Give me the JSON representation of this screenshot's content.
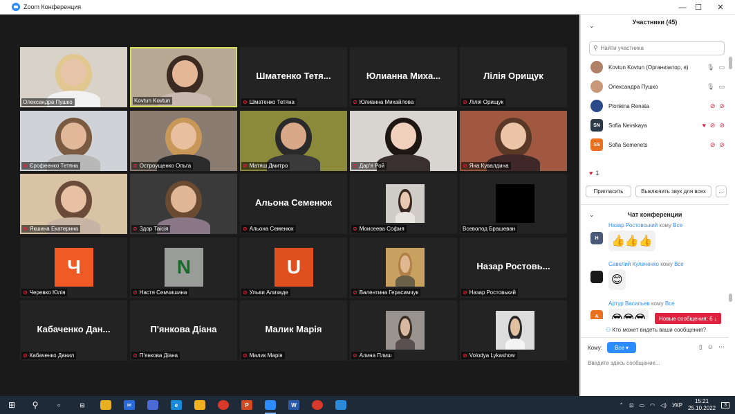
{
  "window": {
    "title": "Zoom Конференция",
    "minimize": "—",
    "maximize": "☐",
    "close": "✕"
  },
  "tiles": [
    {
      "name": "Олександра Пушко",
      "muted": false,
      "kind": "photo",
      "bg": "#d8d2c8",
      "skin": "#e8c4a8",
      "hair": "#e0c890",
      "shirt": "#f1f1f1"
    },
    {
      "name": "Kovtun Kovtun",
      "muted": false,
      "kind": "photo",
      "active": true,
      "bg": "#b6a892",
      "skin": "#e4b896",
      "hair": "#3a2a22",
      "shirt": "#c9b8b0"
    },
    {
      "name": "Шматенко Тетяна",
      "muted": true,
      "kind": "text",
      "display": "Шматенко Тетя..."
    },
    {
      "name": "Юлианна Михайлова",
      "muted": true,
      "kind": "text",
      "display": "Юлианна Миха..."
    },
    {
      "name": "Лілія Орищук",
      "muted": true,
      "kind": "text",
      "display": "Лілія Орищук"
    },
    {
      "name": "Єрофеенко Тетяна",
      "muted": true,
      "kind": "photo",
      "bg": "#cfd2d6",
      "skin": "#e2b89a",
      "hair": "#7a5a40",
      "shirt": "#b8b8b8"
    },
    {
      "name": "Остроущенко Ольга",
      "muted": true,
      "kind": "photo",
      "bg": "#8a7c70",
      "skin": "#e8c0a0",
      "hair": "#c89858",
      "shirt": "#2c2c2c"
    },
    {
      "name": "Матяш Дмитро",
      "muted": true,
      "kind": "photo",
      "bg": "#8a8a3a",
      "skin": "#d8a888",
      "hair": "#2a2a2a",
      "shirt": "#3a3a3a"
    },
    {
      "name": "Дар'я Рой",
      "muted": true,
      "kind": "photo",
      "bg": "#d8d4d0",
      "skin": "#f0d0bc",
      "hair": "#1e1612",
      "shirt": "#3a3030"
    },
    {
      "name": "Яна Кувалдина",
      "muted": true,
      "kind": "photo",
      "bg": "#a05840",
      "skin": "#ecc4a8",
      "hair": "#5a3828",
      "shirt": "#402828"
    },
    {
      "name": "Якшина Екатерина",
      "muted": true,
      "kind": "photo",
      "bg": "#d8c4a4",
      "skin": "#e8c0a4",
      "hair": "#6a4a38",
      "shirt": "#c8b4a4"
    },
    {
      "name": "Здор Таісія",
      "muted": true,
      "kind": "photo",
      "bg": "#3a3a3a",
      "skin": "#e0b898",
      "hair": "#6a4a30",
      "shirt": "#8a7888"
    },
    {
      "name": "Альона Семенюк",
      "muted": true,
      "kind": "text",
      "display": "Альона Семенюк"
    },
    {
      "name": "Моисеева София",
      "muted": true,
      "kind": "small",
      "bg": "#d0ccc8",
      "skin": "#e8c8b0",
      "hair": "#3a2a22",
      "shirt": "#e8e4e0"
    },
    {
      "name": "Всеволод Брашеван",
      "muted": false,
      "kind": "black"
    },
    {
      "name": "Черевко Юлія",
      "muted": true,
      "kind": "avatar",
      "letter": "Ч",
      "color": "#f05a24"
    },
    {
      "name": "Настя Семчишина",
      "muted": true,
      "kind": "avatar",
      "letter": "N",
      "color": "#9a9c9a",
      "lettercolor": "#1a6a2a"
    },
    {
      "name": "Ульви Ализаде",
      "muted": true,
      "kind": "avatar",
      "letter": "U",
      "color": "#e0501e"
    },
    {
      "name": "Валентина Герасимчук",
      "muted": true,
      "kind": "small",
      "bg": "#c8a060",
      "skin": "#e0b890",
      "hair": "#b08048",
      "shirt": "#6a6048"
    },
    {
      "name": "Назар Ростовький",
      "muted": true,
      "kind": "text",
      "display": "Назар Ростовь..."
    },
    {
      "name": "Кабаченко Данил",
      "muted": true,
      "kind": "text",
      "display": "Кабаченко Дан..."
    },
    {
      "name": "П'янкова Діана",
      "muted": true,
      "kind": "text",
      "display": "П'янкова Діана"
    },
    {
      "name": "Малик Марія",
      "muted": true,
      "kind": "text",
      "display": "Малик Марія"
    },
    {
      "name": "Алина Плиш",
      "muted": true,
      "kind": "small",
      "bg": "#9a9490",
      "skin": "#d8b8a0",
      "hair": "#3a3028",
      "shirt": "#5a5050"
    },
    {
      "name": "Volodya Lykashow",
      "muted": true,
      "kind": "small",
      "bg": "#dcdcdc",
      "skin": "#e0c0a0",
      "hair": "#2a2a2a",
      "shirt": "#f4f4f4"
    }
  ],
  "participants": {
    "header": "Участники (45)",
    "search_placeholder": "Найти участника",
    "list": [
      {
        "name": "Kovtun Kovtun (Организатор, я)",
        "av": "",
        "color": "#b08068",
        "icons": [
          "🎙",
          "▭"
        ],
        "iconclass": [
          "gray",
          "gray"
        ]
      },
      {
        "name": "Олександра Пушко",
        "av": "",
        "color": "#c89878",
        "icons": [
          "🎙",
          "▭"
        ],
        "iconclass": [
          "gray",
          "gray"
        ]
      },
      {
        "name": "Plonkina Renata",
        "av": "",
        "color": "#2a4a8a",
        "icons": [
          "⊘",
          "⊘"
        ],
        "iconclass": [
          "red",
          "red"
        ]
      },
      {
        "name": "Sofia Nevskaya",
        "av": "SN",
        "color": "#2d3a48",
        "icons": [
          "♥",
          "⊘",
          "⊘"
        ],
        "iconclass": [
          "red",
          "red",
          "red"
        ]
      },
      {
        "name": "Sofia Semenets",
        "av": "SS",
        "color": "#e8701e",
        "icons": [
          "⊘",
          "⊘"
        ],
        "iconclass": [
          "red",
          "red"
        ]
      }
    ],
    "reaction_icon": "♥",
    "reaction_count": "1",
    "invite_button": "Пригласить",
    "mute_all_button": "Выключить звук для всех",
    "more_button": "…"
  },
  "chat": {
    "header": "Чат конференции",
    "messages": [
      {
        "from": "Назар Ростовський",
        "to_word": "кому",
        "to": "Все",
        "av": "Н",
        "avcolor": "#4a5a78",
        "emoji": "👍👍👍"
      },
      {
        "from": "Савелий Кулаченко",
        "to_word": "кому",
        "to": "Все",
        "av": "",
        "avcolor": "#1a1a1a",
        "emoji": "😊"
      },
      {
        "from": "Артур Васильев",
        "to_word": "кому",
        "to": "Все",
        "av": "А",
        "avcolor": "#e8701e",
        "emoji": "😎😎😎"
      }
    ],
    "new_messages": "Новые сообщения: 6 ↓",
    "who_can_see": "Кто может видеть ваши сообщения?",
    "to_label": "Кому:",
    "to_value": "Все ▾",
    "input_placeholder": "Введите здесь сообщение..."
  },
  "taskbar": {
    "start": "⊞",
    "search": "⚲",
    "apps": [
      {
        "name": "taskview-icon",
        "glyph": "○",
        "color": "transparent"
      },
      {
        "name": "widgets-icon",
        "glyph": "⊟",
        "color": "transparent"
      },
      {
        "name": "explorer-icon",
        "glyph": "",
        "color": "#e8b020"
      },
      {
        "name": "mail-icon",
        "glyph": "✉",
        "color": "#2a6ad8"
      },
      {
        "name": "teams-icon",
        "glyph": "",
        "color": "#4a6ad8"
      },
      {
        "name": "edge-icon",
        "glyph": "e",
        "color": "#1a8ad8"
      },
      {
        "name": "store-icon",
        "glyph": "",
        "color": "#f0b020"
      },
      {
        "name": "chrome-icon",
        "glyph": "",
        "color": "#d83a2a"
      },
      {
        "name": "powerpoint-icon",
        "glyph": "P",
        "color": "#d04a24"
      },
      {
        "name": "zoom-icon",
        "glyph": "",
        "color": "#2d8cff",
        "active": true
      },
      {
        "name": "word-icon",
        "glyph": "W",
        "color": "#2a5aa8"
      },
      {
        "name": "chrome2-icon",
        "glyph": "",
        "color": "#d83a2a"
      },
      {
        "name": "photos-icon",
        "glyph": "",
        "color": "#2a8ad8"
      }
    ],
    "lang": "УКР",
    "time": "15:21",
    "date": "25.10.2022",
    "notif_count": "3"
  }
}
